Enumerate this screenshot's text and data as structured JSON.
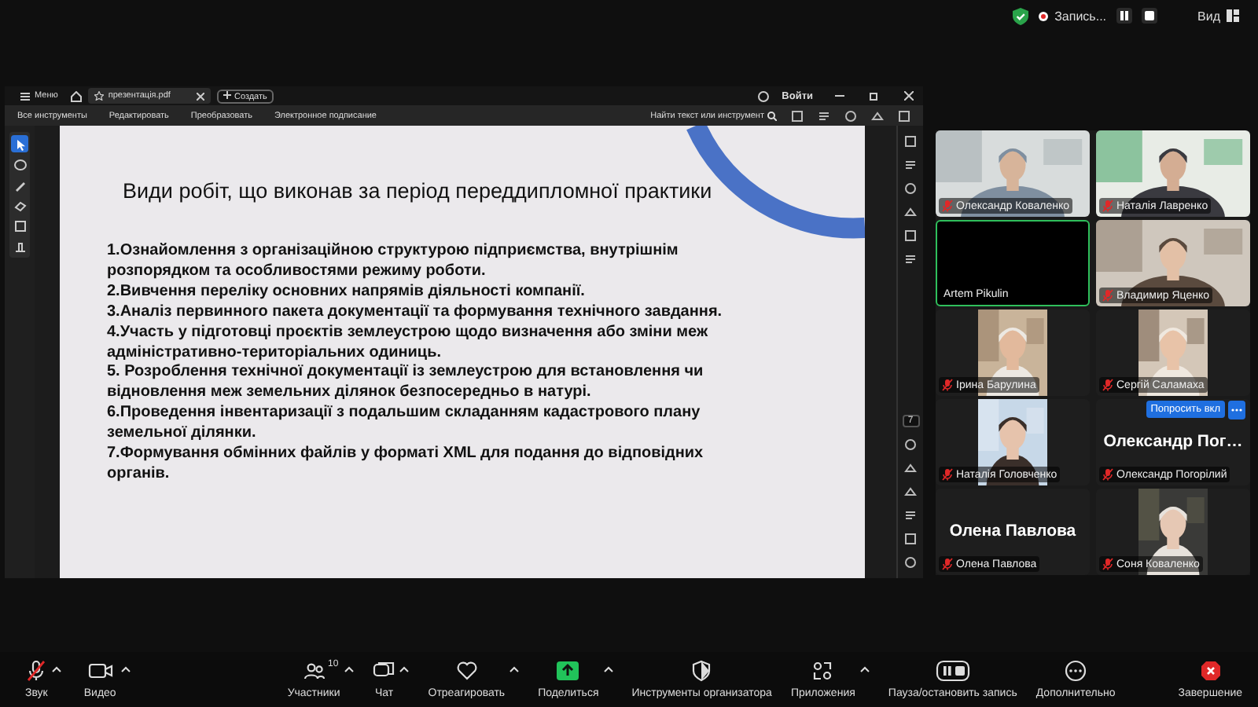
{
  "top_bar": {
    "recording_label": "Запись...",
    "view_label": "Вид"
  },
  "pdf_viewer": {
    "menu_label": "Меню",
    "tabs": [
      {
        "label": "презентація.pdf",
        "selected": true
      }
    ],
    "new_tab_label": "Создать",
    "sign_in_label": "Войти",
    "tools": [
      "Все инструменты",
      "Редактировать",
      "Преобразовать",
      "Электронное подписание"
    ],
    "find_label": "Найти текст или инструмент",
    "left_tools": [
      {
        "selected": true
      },
      {
        "selected": false
      },
      {
        "selected": false
      },
      {
        "selected": false
      },
      {
        "selected": false
      },
      {
        "selected": false
      }
    ],
    "page_number": "7",
    "slide": {
      "title": "Види робіт, що виконав за період переддипломної практики",
      "items": [
        "1.Ознайомлення з організаційною структурою підприємства, внутрішнім розпорядком та особливостями режиму роботи.",
        "2.Вивчення переліку основних напрямів діяльності компанії.",
        "3.Аналіз первинного пакета документації та формування технічного завдання.",
        "4.Участь у підготовці проєктів землеустрою щодо визначення або зміни меж адміністративно-територіальних одиниць.",
        "5. Розроблення технічної документації із землеустрою для встановлення чи відновлення меж земельних ділянок безпосередньо в натурі.",
        "6.Проведення інвентаризації з подальшим складанням кадастрового плану земельної ділянки.",
        "7.Формування обмінних файлів у форматі XML для подання до відповідних органів."
      ]
    }
  },
  "participants": {
    "tiles": [
      {
        "name": "Олександр Коваленко",
        "muted": true,
        "kind": "video",
        "active_speaker": false
      },
      {
        "name": "Наталія Лавренко",
        "muted": true,
        "kind": "video",
        "active_speaker": false
      },
      {
        "name": "Artem Pikulin",
        "muted": false,
        "kind": "off",
        "active_speaker": true
      },
      {
        "name": "Владимир Яценко",
        "muted": true,
        "kind": "video",
        "active_speaker": false
      },
      {
        "name": "Ірина Барулина",
        "muted": true,
        "kind": "portrait",
        "active_speaker": false
      },
      {
        "name": "Сергій Саламаха",
        "muted": true,
        "kind": "portrait",
        "active_speaker": false
      },
      {
        "name": "Наталія Головченко",
        "muted": true,
        "kind": "portrait",
        "active_speaker": false
      },
      {
        "name": "Олександр Погорілий",
        "muted": true,
        "kind": "name",
        "big_name": "Олександр Пог…",
        "active_speaker": false
      },
      {
        "name": "Олена Павлова",
        "muted": true,
        "kind": "name",
        "big_name": "Олена Павлова",
        "active_speaker": false
      },
      {
        "name": "Соня Коваленко",
        "muted": true,
        "kind": "portrait",
        "active_speaker": false
      }
    ],
    "ask_button_label": "Попросить вкл"
  },
  "toolbar": {
    "items": [
      {
        "kind": "mic",
        "label": "Звук",
        "muted": true,
        "caret": true
      },
      {
        "kind": "video",
        "label": "Видео",
        "caret": true
      },
      {
        "kind": "participants",
        "label": "Участники",
        "count": "10",
        "caret": true
      },
      {
        "kind": "chat",
        "label": "Чат",
        "caret": true
      },
      {
        "kind": "react",
        "label": "Отреагировать",
        "caret": true
      },
      {
        "kind": "share",
        "label": "Поделиться",
        "caret": true
      },
      {
        "kind": "host",
        "label": "Инструменты организатора",
        "caret": false
      },
      {
        "kind": "apps",
        "label": "Приложения",
        "caret": true
      },
      {
        "kind": "record",
        "label": "Пауза/остановить запись",
        "caret": false
      },
      {
        "kind": "more",
        "label": "Дополнительно",
        "caret": false
      },
      {
        "kind": "end",
        "label": "Завершение",
        "caret": false
      }
    ]
  }
}
